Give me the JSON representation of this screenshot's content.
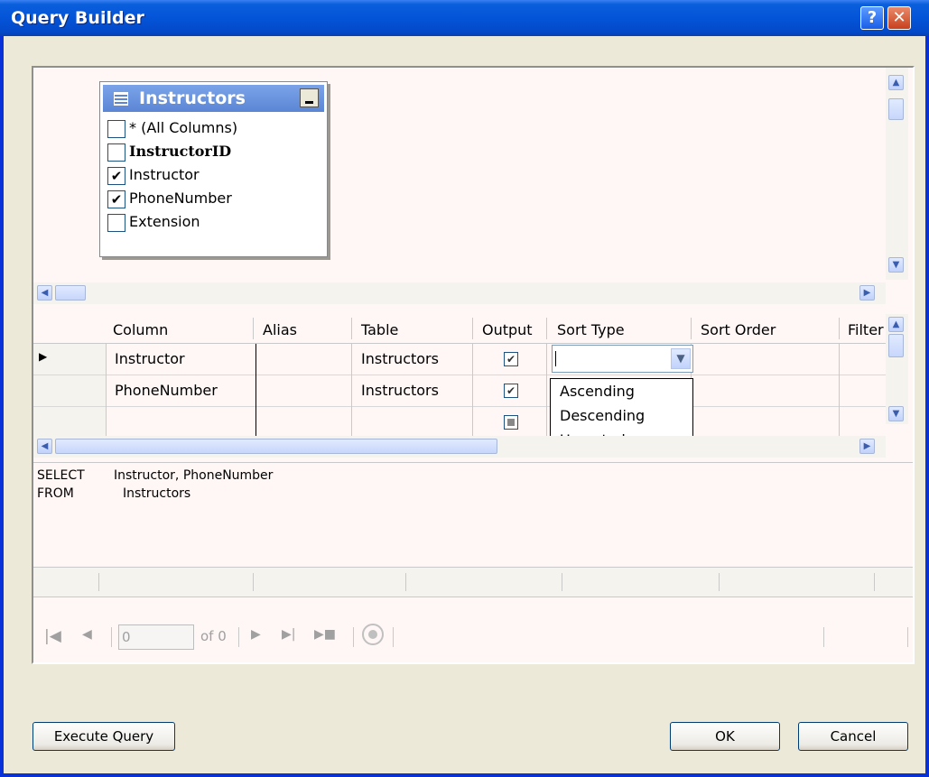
{
  "window": {
    "title": "Query Builder",
    "help_glyph": "?",
    "close_glyph": "✕"
  },
  "diagram": {
    "table_name": "Instructors",
    "columns": [
      {
        "label": "* (All Columns)",
        "checked": false,
        "bold": false
      },
      {
        "label": "InstructorID",
        "checked": false,
        "bold": true
      },
      {
        "label": "Instructor",
        "checked": true,
        "bold": false
      },
      {
        "label": "PhoneNumber",
        "checked": true,
        "bold": false
      },
      {
        "label": "Extension",
        "checked": false,
        "bold": false
      }
    ]
  },
  "grid": {
    "headers": {
      "column": "Column",
      "alias": "Alias",
      "table": "Table",
      "output": "Output",
      "sort_type": "Sort Type",
      "sort_order": "Sort Order",
      "filter": "Filter"
    },
    "rows": [
      {
        "column": "Instructor",
        "alias": "",
        "table": "Instructors",
        "output": true
      },
      {
        "column": "PhoneNumber",
        "alias": "",
        "table": "Instructors",
        "output": true
      },
      {
        "column": "",
        "alias": "",
        "table": "",
        "output": false
      }
    ],
    "sort_type_value": "",
    "sort_type_options": [
      "Ascending",
      "Descending",
      "Unsorted"
    ]
  },
  "sql": {
    "select_keyword": "SELECT",
    "select_columns": "Instructor, PhoneNumber",
    "from_keyword": "FROM",
    "from_table": "Instructors"
  },
  "results_nav": {
    "position": "0",
    "of_text": "of 0"
  },
  "buttons": {
    "execute": "Execute Query",
    "ok": "OK",
    "cancel": "Cancel"
  }
}
